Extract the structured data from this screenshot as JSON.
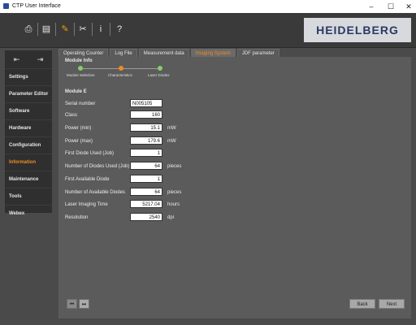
{
  "window": {
    "title": "CTP User Interface",
    "controls": {
      "minimize": "–",
      "maximize": "☐",
      "close": "✕"
    }
  },
  "toolbar": {
    "icons": [
      "printer-icon",
      "document-icon",
      "wrench-icon",
      "tools-icon",
      "info-icon",
      "help-icon"
    ],
    "brand": "HEIDELBERG",
    "colors": {
      "accent": "#f0a000",
      "brand_bg": "#d7d9dc"
    }
  },
  "sidebar": {
    "arrows": [
      "⇤",
      "⇥"
    ],
    "items": [
      {
        "label": "Settings"
      },
      {
        "label": "Parameter Editor"
      },
      {
        "label": "Software"
      },
      {
        "label": "Hardware"
      },
      {
        "label": "Configuration"
      },
      {
        "label": "Information",
        "active": true
      },
      {
        "label": "Maintenance"
      },
      {
        "label": "Tools"
      },
      {
        "label": "Webex"
      }
    ]
  },
  "tabs": [
    {
      "label": "Operating Counter"
    },
    {
      "label": "Log File"
    },
    {
      "label": "Measurement data"
    },
    {
      "label": "Imaging System",
      "active": true
    },
    {
      "label": "JDF parameter"
    }
  ],
  "main": {
    "section_title": "Module Info",
    "steps": [
      {
        "label": "Module Selection",
        "color": "#7fcf6a"
      },
      {
        "label": "Characteristics",
        "color": "#f08a24"
      },
      {
        "label": "Laser Diodes",
        "color": "#7fcf6a"
      }
    ],
    "module_title": "Module E",
    "fields": [
      {
        "label": "Serial number",
        "value": "N005105",
        "unit": ""
      },
      {
        "label": "Class",
        "value": "160",
        "unit": ""
      },
      {
        "label": "Power (min)",
        "value": "15.1",
        "unit": "mW"
      },
      {
        "label": "Power (max)",
        "value": "179.6",
        "unit": "mW"
      },
      {
        "label": "First Diode Used (Job)",
        "value": "1",
        "unit": ""
      },
      {
        "label": "Number of Diodes Used (Job)",
        "value": "64",
        "unit": "pieces"
      },
      {
        "label": "First Available Diode",
        "value": "1",
        "unit": ""
      },
      {
        "label": "Number of Available Diodes",
        "value": "64",
        "unit": "pieces"
      },
      {
        "label": "Laser Imaging Time",
        "value": "5217.04",
        "unit": "hours"
      },
      {
        "label": "Resolution",
        "value": "2540",
        "unit": "dpi"
      }
    ],
    "nav_first": "⏮",
    "nav_last": "⏭",
    "back_label": "Back",
    "next_label": "Next"
  }
}
